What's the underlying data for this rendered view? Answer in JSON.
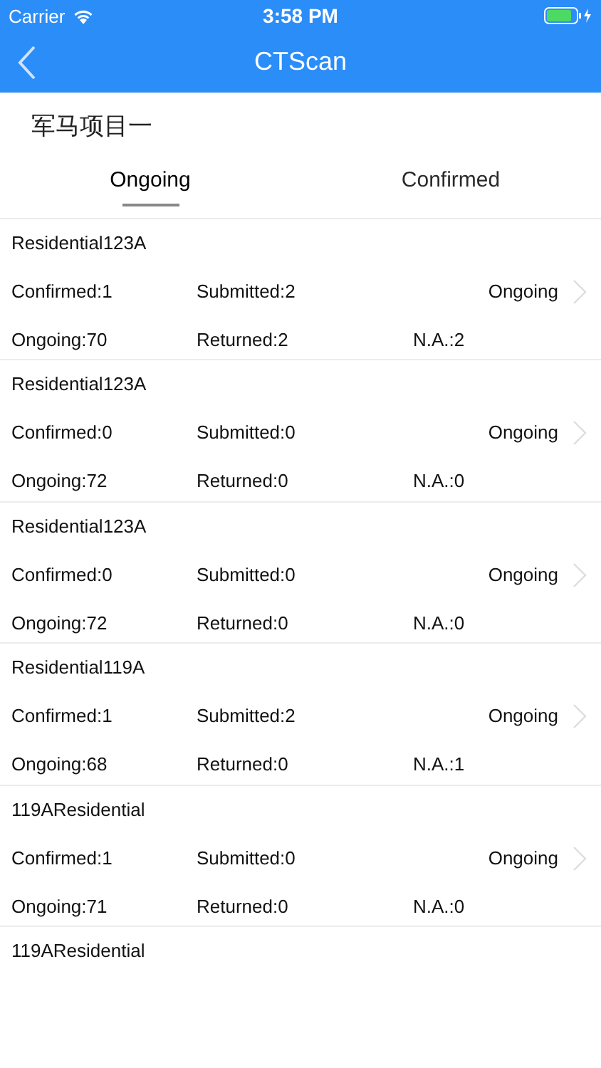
{
  "status_bar": {
    "carrier": "Carrier",
    "time": "3:58 PM"
  },
  "nav": {
    "title": "CTScan"
  },
  "project": "军马项目一",
  "tabs": [
    {
      "label": "Ongoing",
      "selected": true
    },
    {
      "label": "Confirmed",
      "selected": false
    }
  ],
  "items": [
    {
      "name": "Residential123A",
      "confirmed": "Confirmed:1",
      "submitted": "Submitted:2",
      "status": "Ongoing",
      "ongoing": "Ongoing:70",
      "returned": "Returned:2",
      "na": "N.A.:2"
    },
    {
      "name": "Residential123A",
      "confirmed": "Confirmed:0",
      "submitted": "Submitted:0",
      "status": "Ongoing",
      "ongoing": "Ongoing:72",
      "returned": "Returned:0",
      "na": "N.A.:0"
    },
    {
      "name": "Residential123A",
      "confirmed": "Confirmed:0",
      "submitted": "Submitted:0",
      "status": "Ongoing",
      "ongoing": "Ongoing:72",
      "returned": "Returned:0",
      "na": "N.A.:0"
    },
    {
      "name": "Residential119A",
      "confirmed": "Confirmed:1",
      "submitted": "Submitted:2",
      "status": "Ongoing",
      "ongoing": "Ongoing:68",
      "returned": "Returned:0",
      "na": "N.A.:1"
    },
    {
      "name": "119AResidential",
      "confirmed": "Confirmed:1",
      "submitted": "Submitted:0",
      "status": "Ongoing",
      "ongoing": "Ongoing:71",
      "returned": "Returned:0",
      "na": "N.A.:0"
    },
    {
      "name": "119AResidential"
    }
  ]
}
